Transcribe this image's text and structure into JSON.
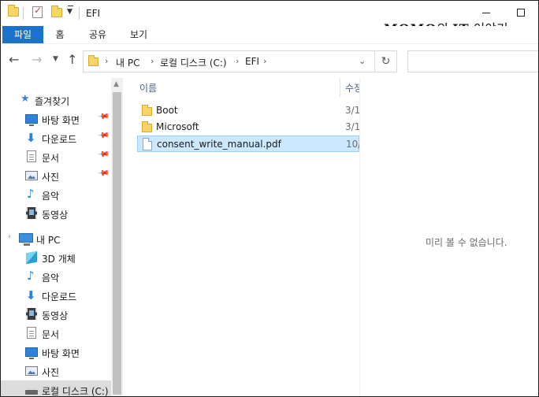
{
  "window": {
    "title": "EFI"
  },
  "watermark": {
    "strong": "MOMO",
    "mid": "의 ",
    "strong2": "IT",
    "tail": " 이야기"
  },
  "ribbon": {
    "tabs": [
      "파일",
      "홈",
      "공유",
      "보기"
    ]
  },
  "address": {
    "crumbs": [
      "내 PC",
      "로컬 디스크 (C:)",
      "EFI"
    ],
    "search_placeholder": ""
  },
  "nav": {
    "quick_access": "즐겨찾기",
    "quick_items": [
      "바탕 화면",
      "다운로드",
      "문서",
      "사진",
      "음악",
      "동영상"
    ],
    "this_pc": "내 PC",
    "pc_items": [
      "3D 개체",
      "음악",
      "다운로드",
      "동영상",
      "문서",
      "바탕 화면",
      "사진",
      "로컬 디스크 (C:)"
    ]
  },
  "file_list": {
    "columns": {
      "name": "이름",
      "date": "수정한 날짜"
    },
    "rows": [
      {
        "name": "Boot",
        "type": "folder",
        "date": "3/1"
      },
      {
        "name": "Microsoft",
        "type": "folder",
        "date": "3/1"
      },
      {
        "name": "consent_write_manual.pdf",
        "type": "file",
        "date": "10/"
      }
    ]
  },
  "preview": {
    "message": "미리 볼 수 없습니다."
  },
  "colors": {
    "accent": "#1a73c9",
    "selection": "#cce8ff",
    "selection_border": "#99d1ff"
  }
}
